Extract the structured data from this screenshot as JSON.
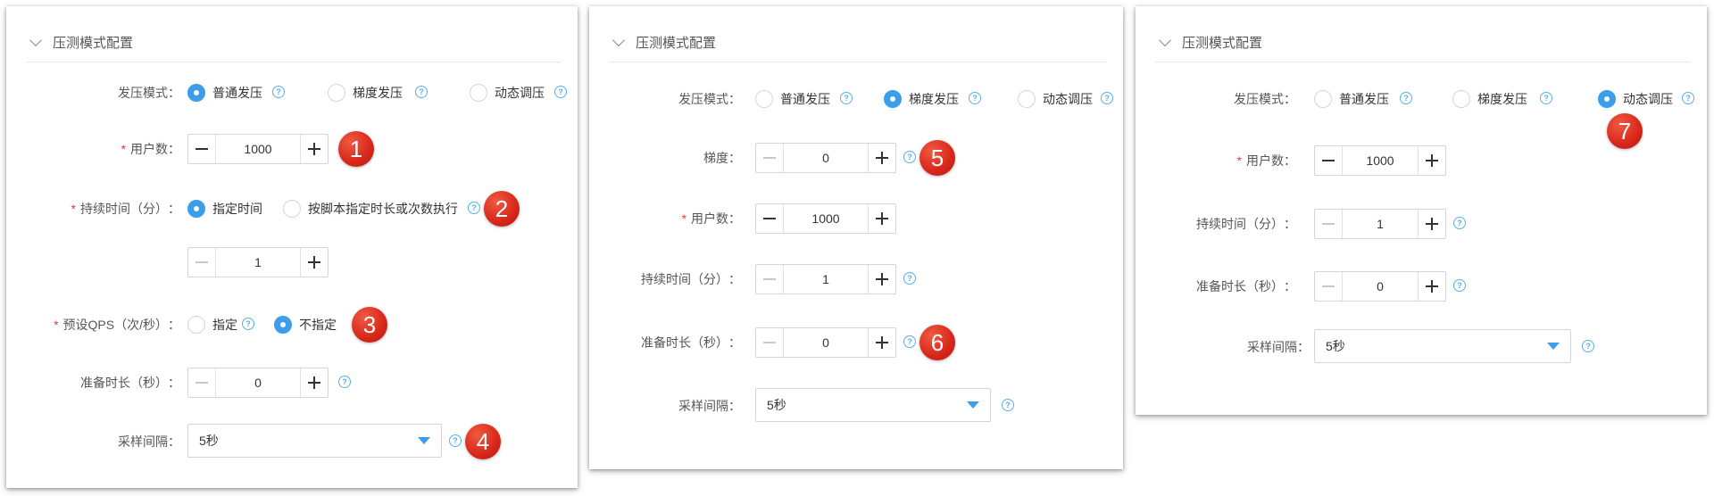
{
  "panels": [
    {
      "title": "压测模式配置",
      "mode_label": "发压模式",
      "modes": [
        "普通发压",
        "梯度发压",
        "动态调压"
      ],
      "users_label": "用户数",
      "users_value": "1000",
      "duration_label": "持续时间（分）",
      "duration_opt_specified": "指定时间",
      "duration_opt_script": "按脚本指定时长或次数执行",
      "duration_value": "1",
      "qps_label": "预设QPS（次/秒）",
      "qps_opt_specified": "指定",
      "qps_opt_unspecified": "不指定",
      "prep_label": "准备时长（秒）",
      "prep_value": "0",
      "sample_label": "采样间隔",
      "sample_value": "5秒",
      "badges": [
        "1",
        "2",
        "3",
        "4"
      ]
    },
    {
      "title": "压测模式配置",
      "mode_label": "发压模式",
      "modes": [
        "普通发压",
        "梯度发压",
        "动态调压"
      ],
      "gradient_label": "梯度",
      "gradient_value": "0",
      "users_label": "用户数",
      "users_value": "1000",
      "duration_label": "持续时间（分）",
      "duration_value": "1",
      "prep_label": "准备时长（秒）",
      "prep_value": "0",
      "sample_label": "采样间隔",
      "sample_value": "5秒",
      "badges": [
        "5",
        "6"
      ]
    },
    {
      "title": "压测模式配置",
      "mode_label": "发压模式",
      "modes": [
        "普通发压",
        "梯度发压",
        "动态调压"
      ],
      "users_label": "用户数",
      "users_value": "1000",
      "duration_label": "持续时间（分）",
      "duration_value": "1",
      "prep_label": "准备时长（秒）",
      "prep_value": "0",
      "sample_label": "采样间隔",
      "sample_value": "5秒",
      "badges": [
        "7"
      ]
    }
  ],
  "colors": {
    "accent": "#3c9dea",
    "required": "#e83a3a",
    "badge": "#d8261a",
    "help": "#5aaee8"
  },
  "icons": {
    "help": "question-circle-icon",
    "collapse": "chevron-down-icon",
    "dropdown": "caret-down-icon"
  }
}
